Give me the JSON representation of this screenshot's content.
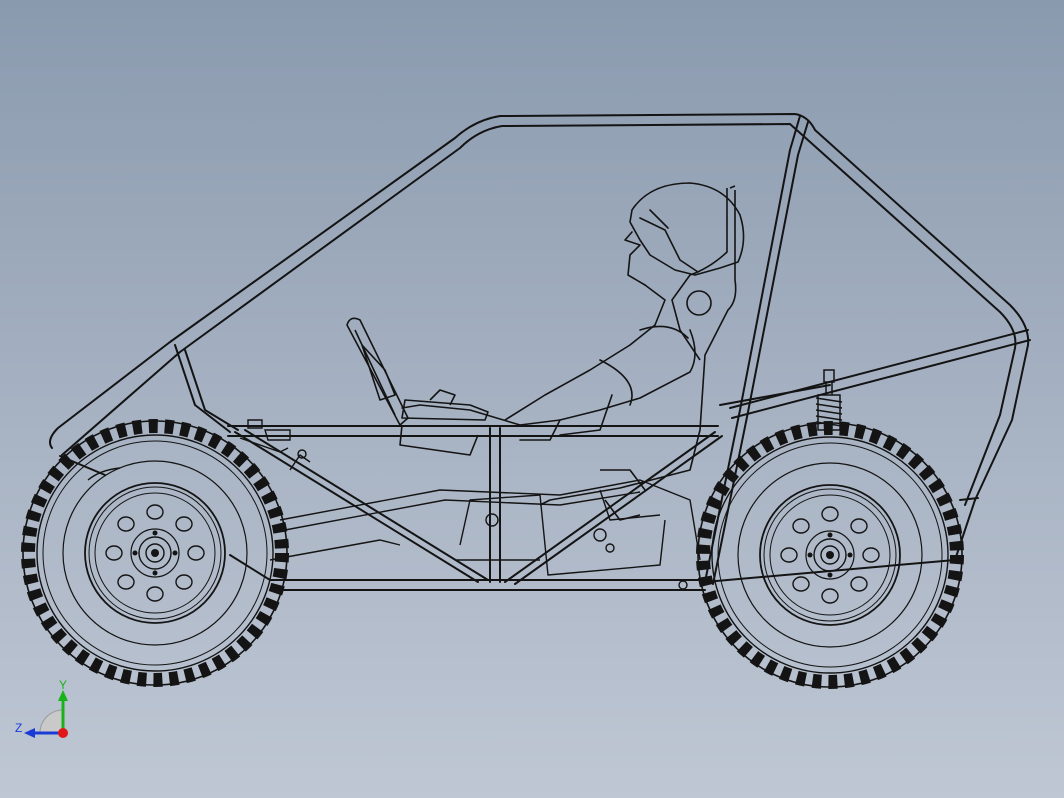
{
  "viewport": {
    "background_top": "#8a9aae",
    "background_bottom": "#bfc7d4",
    "line_color": "#141414"
  },
  "model": {
    "frame": "tube-frame",
    "front_wheel": "wheel",
    "rear_wheel": "wheel",
    "driver": "driver-figure",
    "steering": "steering-wheel",
    "shock": "coil-shock"
  },
  "triad": {
    "y_label": "Y",
    "z_label": "Z",
    "y_color": "#19b219",
    "z_color": "#1a3cd6",
    "x_color": "#e01818"
  }
}
